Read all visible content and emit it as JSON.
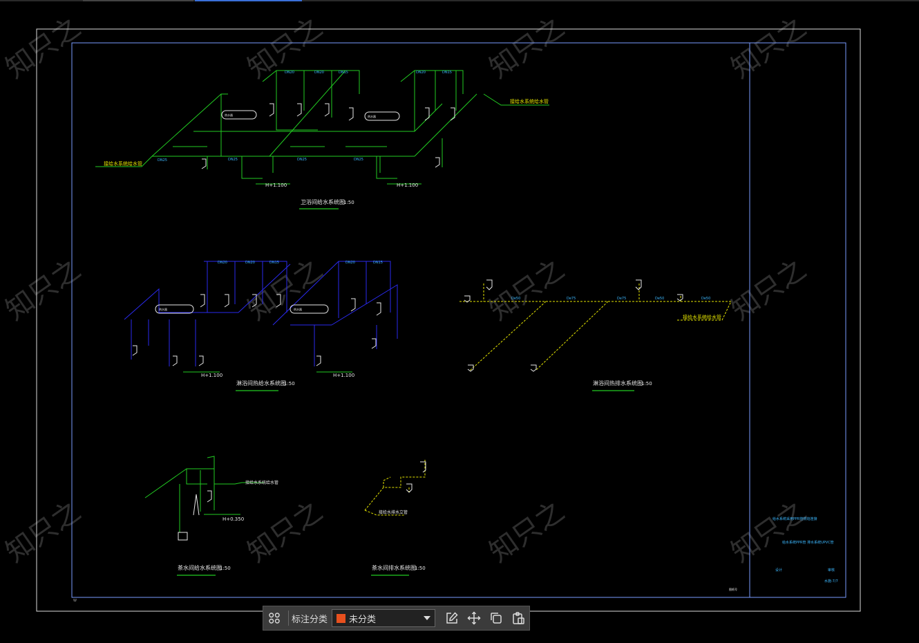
{
  "colors": {
    "green": "#22cc22",
    "blue": "#2a2aee",
    "yellow": "#e6e600",
    "white": "#e8e8e8",
    "frame": "#7a9cff",
    "cyan": "#3cb8ff",
    "watermark": "#555555"
  },
  "drawing": {
    "watermark_text": "知只之",
    "views": [
      {
        "title": "卫浴间给水系统图",
        "scale": "1:50"
      },
      {
        "title": "淋浴间热给水系统图",
        "scale": "1:50"
      },
      {
        "title": "淋浴间热排水系统图",
        "scale": "1:50"
      },
      {
        "title": "茶水间给水系统图",
        "scale": "1:50"
      },
      {
        "title": "茶水间排水系统图",
        "scale": "1:50"
      }
    ],
    "annotations": {
      "supply_in_1": "接给水系统给水管",
      "supply_in_2": "接给水系统给水管",
      "drain_out": "接给水系统给水管",
      "tea_supply": "接给水系统给水管",
      "tea_drain": "接给水排水立管",
      "level_1": "H+1.100",
      "level_2": "H+1.100",
      "level_3": "H+1.100",
      "level_4": "H+1.100",
      "level_5": "H+0.350",
      "pipe_de": "DN25",
      "pipe_dn20": "DN20",
      "pipe_dn15": "DN15",
      "pipe_de50": "De50",
      "pipe_de75": "De75",
      "heater": "热水器",
      "tb_note_1": "给水系统采用PPR管热熔连接",
      "tb_note_2": "给水系统PPR管 排水系统UPVC管",
      "tb_designer": "设计",
      "tb_checker": "审核",
      "tb_sheet": "水施-7/7",
      "tb_stamp": "图纸号",
      "corner_mark": "W"
    }
  },
  "toolbar": {
    "grid_icon": "grid-icon",
    "label": "标注分类",
    "selected": "未分类",
    "swatch_color": "#e8501e",
    "icons": [
      "edit-icon",
      "move-icon",
      "copy-icon",
      "paste-icon"
    ]
  }
}
